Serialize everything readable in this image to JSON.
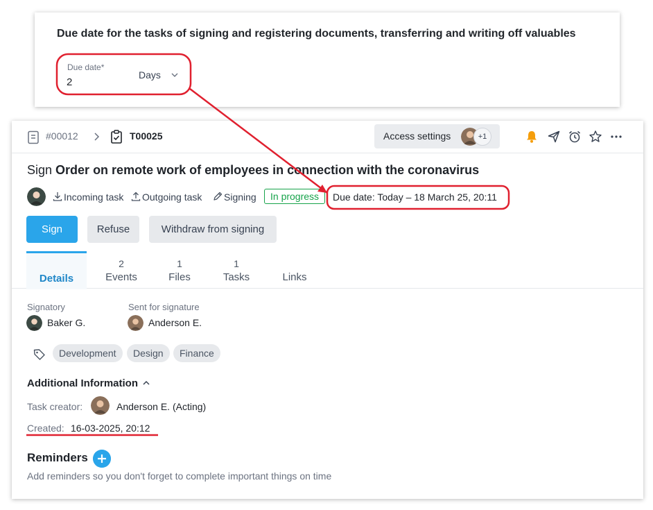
{
  "settings": {
    "title": "Due date for the tasks of signing and registering documents, transferring and writing off valuables",
    "due_label": "Due date*",
    "due_value": "2",
    "due_unit": "Days"
  },
  "header": {
    "doc_number": "#00012",
    "task_number": "T00025",
    "access_label": "Access settings",
    "access_extra": "+1"
  },
  "task": {
    "title_verb": "Sign",
    "title_name": "Order on remote work of employees in connection with the coronavirus",
    "incoming": "Incoming task",
    "outgoing": "Outgoing task",
    "signing": "Signing",
    "status": "In progress",
    "due": "Due date: Today – 18 March 25, 20:11"
  },
  "actions": {
    "sign": "Sign",
    "refuse": "Refuse",
    "withdraw": "Withdraw from signing"
  },
  "tabs": [
    {
      "label": "Details",
      "count": ""
    },
    {
      "label": "Events",
      "count": "2"
    },
    {
      "label": "Files",
      "count": "1"
    },
    {
      "label": "Tasks",
      "count": "1"
    },
    {
      "label": "Links",
      "count": ""
    }
  ],
  "details": {
    "signatory_label": "Signatory",
    "signatory_name": "Baker G.",
    "sent_label": "Sent for signature",
    "sent_name": "Anderson E.",
    "tags": [
      "Development",
      "Design",
      "Finance"
    ]
  },
  "additional": {
    "title": "Additional Information",
    "creator_label": "Task creator:",
    "creator_name": "Anderson E. (Acting)",
    "created_label": "Created:",
    "created_value": "16-03-2025, 20:12"
  },
  "reminders": {
    "title": "Reminders",
    "hint": "Add reminders so you don't forget to complete important things on time"
  },
  "colors": {
    "accent": "#2aa5ea",
    "status_green": "#16a34a",
    "annotation_red": "#e0202f",
    "bell_orange": "#f59e0b"
  }
}
